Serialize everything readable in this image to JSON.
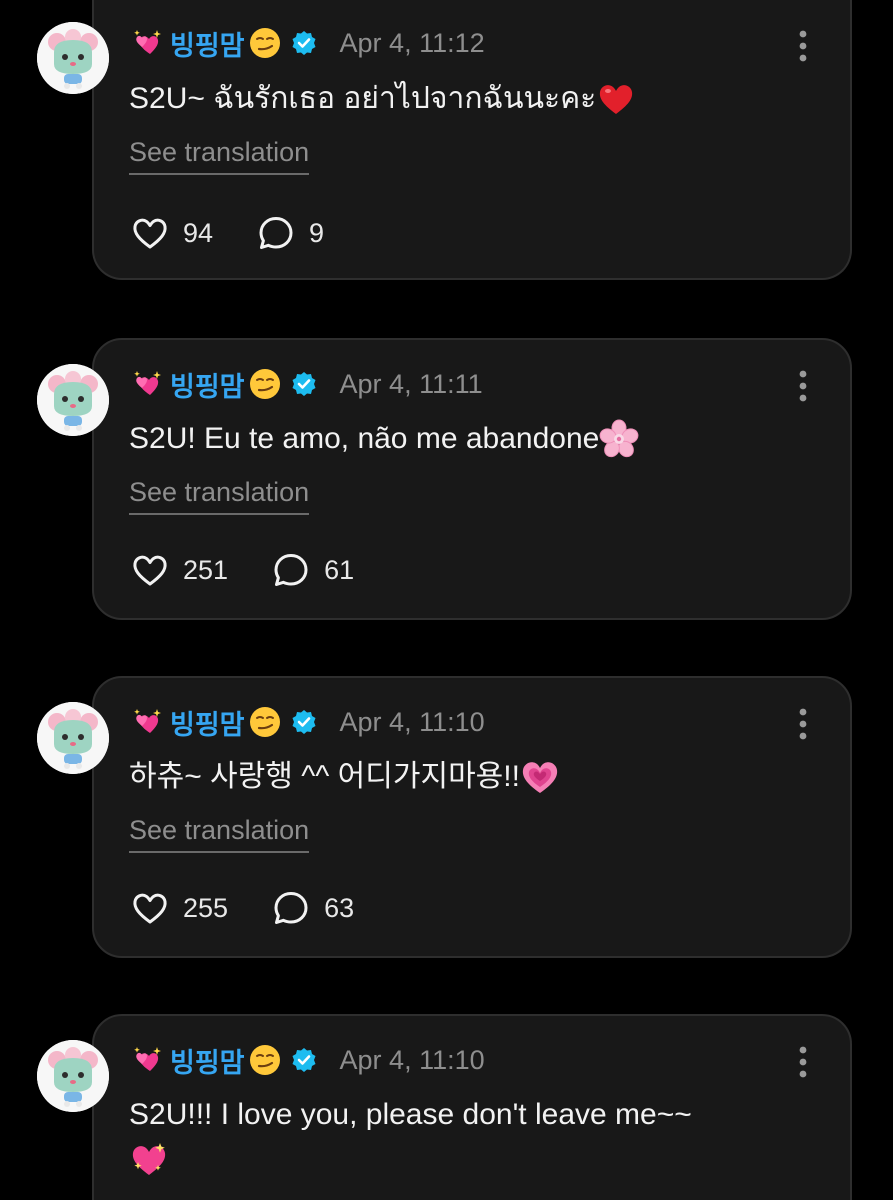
{
  "colors": {
    "background": "#000000",
    "card": "#181818",
    "card_border": "#2e2e2e",
    "username": "#36a6f2",
    "verified_badge": "#1dbcf0",
    "muted": "#8e8e8e",
    "text": "#f2f2f2"
  },
  "posts": [
    {
      "username": "빙핑맘",
      "name_emoji_lead": "sparkling-hearts-emoji",
      "name_emoji_trail": "smirk-emoji",
      "verified_icon": "verified-badge-icon",
      "timestamp": "Apr 4, 11:12",
      "text": "S2U~ ฉันรักเธอ อย่าไปจากฉันนะคะ",
      "text_emoji": "red-heart-emoji",
      "see_translation": "See translation",
      "likes": "94",
      "comments": "9"
    },
    {
      "username": "빙핑맘",
      "name_emoji_lead": "sparkling-hearts-emoji",
      "name_emoji_trail": "smirk-emoji",
      "verified_icon": "verified-badge-icon",
      "timestamp": "Apr 4, 11:11",
      "text": "S2U! Eu te amo, não me abandone",
      "text_emoji": "cherry-blossom-emoji",
      "see_translation": "See translation",
      "likes": "251",
      "comments": "61"
    },
    {
      "username": "빙핑맘",
      "name_emoji_lead": "sparkling-hearts-emoji",
      "name_emoji_trail": "smirk-emoji",
      "verified_icon": "verified-badge-icon",
      "timestamp": "Apr 4, 11:10",
      "text": "하츄~ 사랑행 ^^ 어디가지마용!!",
      "text_emoji": "growing-heart-emoji",
      "see_translation": "See translation",
      "likes": "255",
      "comments": "63"
    },
    {
      "username": "빙핑맘",
      "name_emoji_lead": "sparkling-hearts-emoji",
      "name_emoji_trail": "smirk-emoji",
      "verified_icon": "verified-badge-icon",
      "timestamp": "Apr 4, 11:10",
      "text": "S2U!!! I love you, please don't leave me~~",
      "text_emoji": "sparkling-heart-emoji"
    }
  ],
  "icons": {
    "like": "heart-outline-icon",
    "comment": "speech-bubble-icon",
    "more": "vertical-dots-icon",
    "avatar": "cartoon-character-avatar"
  }
}
